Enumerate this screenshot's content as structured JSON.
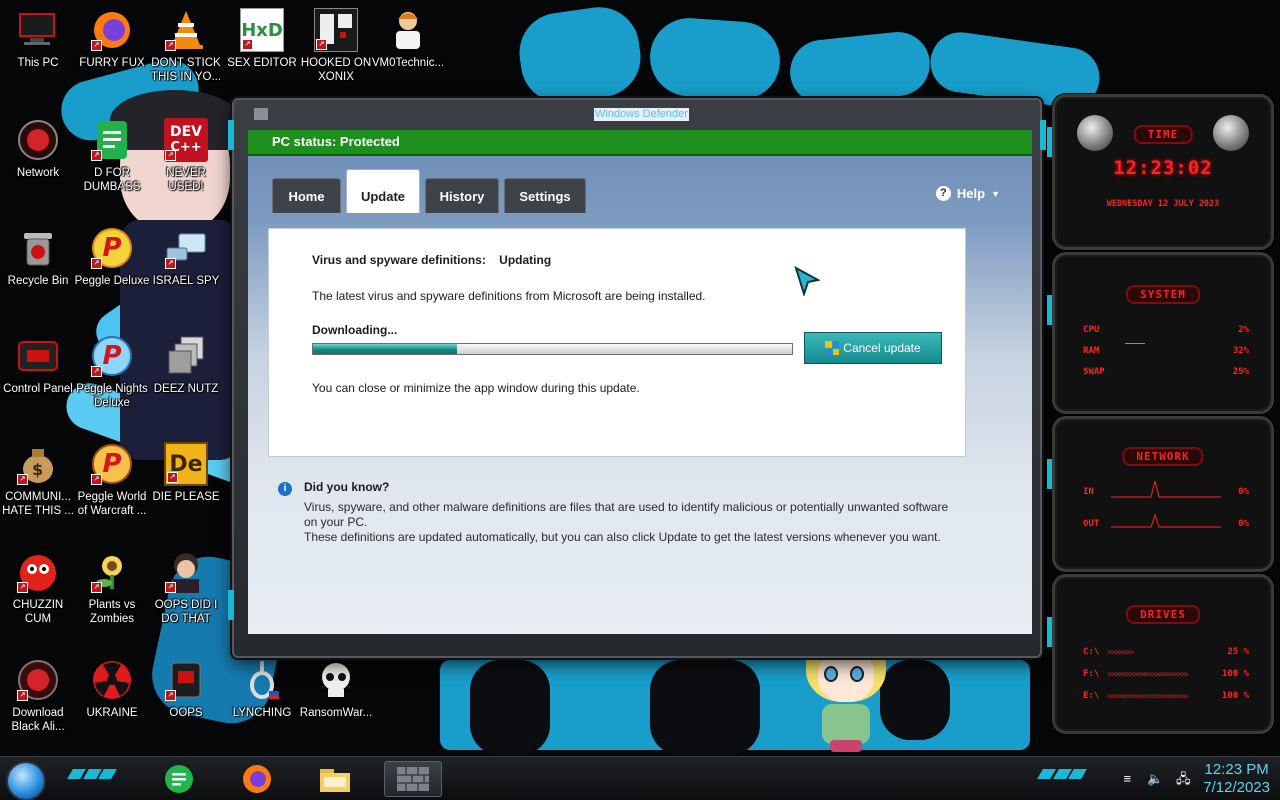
{
  "desktop": {
    "icons": [
      {
        "label": "This PC"
      },
      {
        "label": "FURRY FUX"
      },
      {
        "label": "DONT STICK THIS IN YO..."
      },
      {
        "label": "SEX EDITOR"
      },
      {
        "label": "HOOKED ON XONIX"
      },
      {
        "label": "VM0Technic..."
      },
      {
        "label": "Network"
      },
      {
        "label": "D FOR DUMBASS"
      },
      {
        "label": "NEVER USED!"
      },
      {
        "label": "Recycle Bin"
      },
      {
        "label": "Peggle Deluxe"
      },
      {
        "label": "ISRAEL SPY"
      },
      {
        "label": "Control Panel"
      },
      {
        "label": "Peggle Nights Deluxe"
      },
      {
        "label": "DEEZ NUTZ"
      },
      {
        "label": "COMMUNI... HATE THIS ..."
      },
      {
        "label": "Peggle World of Warcraft ..."
      },
      {
        "label": "DIE PLEASE"
      },
      {
        "label": "CHUZZIN CUM"
      },
      {
        "label": "Plants vs Zombies"
      },
      {
        "label": "OOPS DID I DO THAT"
      },
      {
        "label": "Download Black Ali..."
      },
      {
        "label": "UKRAINE"
      },
      {
        "label": "OOPS"
      },
      {
        "label": "LYNCHING"
      },
      {
        "label": "RansomWar..."
      }
    ],
    "icon_glyphs": {
      "dev": "DEV",
      "devpp": "C++",
      "hxd": "HxD",
      "de": "De",
      "peggle": "P"
    }
  },
  "defender": {
    "window_title": "Windows Defender",
    "status": "PC status: Protected",
    "tabs": [
      {
        "label": "Home",
        "active": false
      },
      {
        "label": "Update",
        "active": true
      },
      {
        "label": "History",
        "active": false
      },
      {
        "label": "Settings",
        "active": false
      }
    ],
    "help_label": "Help",
    "update": {
      "definitions_label": "Virus and spyware definitions:",
      "definitions_status": "Updating",
      "description": "The latest virus and spyware definitions from Microsoft are being installed.",
      "downloading_label": "Downloading...",
      "progress_percent": 30,
      "cancel_button": "Cancel update",
      "note": "You can close or minimize the app window during this update."
    },
    "did_you_know": {
      "heading": "Did you know?",
      "line1": "Virus, spyware, and other malware definitions are files that are used to identify malicious or potentially unwanted software",
      "line2": "on your PC.",
      "line3": "These definitions are updated automatically, but you can also click Update to get the latest versions whenever you want."
    },
    "colors": {
      "status_green": "#1c8f1c",
      "progress_teal": "#1c8f86",
      "accent_cyan": "#19b9d6"
    }
  },
  "gadgets": {
    "time": {
      "title": "TIME",
      "clock": "12:23:02",
      "date": "WEDNESDAY 12 JULY 2023"
    },
    "system": {
      "title": "SYSTEM",
      "rows": [
        {
          "label": "CPU",
          "value": "2%"
        },
        {
          "label": "RAM",
          "value": "32%"
        },
        {
          "label": "SWAP",
          "value": "25%"
        }
      ]
    },
    "network": {
      "title": "NETWORK",
      "rows": [
        {
          "label": "IN",
          "value": "0%"
        },
        {
          "label": "OUT",
          "value": "0%"
        }
      ]
    },
    "drives": {
      "title": "DRIVES",
      "rows": [
        {
          "label": "C:\\",
          "value": "25 %"
        },
        {
          "label": "F:\\",
          "value": "100 %"
        },
        {
          "label": "E:\\",
          "value": "100 %"
        }
      ]
    },
    "colors": {
      "red": "#ff2020"
    }
  },
  "taskbar": {
    "clock_time": "12:23 PM",
    "clock_date": "7/12/2023"
  }
}
